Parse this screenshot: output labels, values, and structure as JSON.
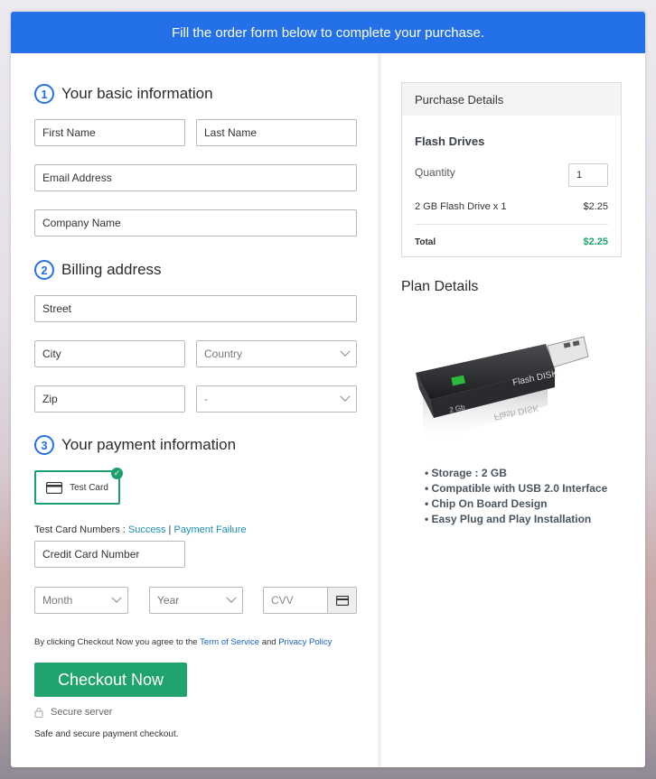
{
  "banner": "Fill the order form below to complete your purchase.",
  "sections": {
    "basic": {
      "num": "1",
      "title": "Your basic information"
    },
    "billing": {
      "num": "2",
      "title": "Billing address"
    },
    "payment": {
      "num": "3",
      "title": "Your payment information"
    }
  },
  "fields": {
    "first_name": "First Name",
    "last_name": "Last Name",
    "email": "Email Address",
    "company": "Company Name",
    "street": "Street",
    "city": "City",
    "country": "Country",
    "zip": "Zip",
    "state": "-",
    "card_number": "Credit Card Number",
    "month": "Month",
    "year": "Year",
    "cvv": "CVV"
  },
  "payment": {
    "test_card": "Test Card",
    "test_numbers_label": "Test Card Numbers : ",
    "success": "Success",
    "separator": " | ",
    "failure": "Payment Failure"
  },
  "terms": {
    "prefix": "By clicking Checkout Now you agree to the ",
    "tos": "Term of Service",
    "and": " and ",
    "privacy": "Privacy Policy"
  },
  "checkout_label": "Checkout Now",
  "secure_server": "Secure server",
  "secure_note": "Safe and secure payment checkout.",
  "purchase": {
    "header": "Purchase Details",
    "product": "Flash Drives",
    "quantity_label": "Quantity",
    "quantity_value": "1",
    "line_item": "2 GB Flash Drive x 1",
    "line_price": "$2.25",
    "total_label": "Total",
    "total_value": "$2.25"
  },
  "plan": {
    "title": "Plan Details",
    "brand_label": "Flash DISK",
    "size_label": "2 Gb",
    "features": [
      "Storage : 2 GB",
      "Compatible with USB 2.0 Interface",
      "Chip On Board Design",
      "Easy Plug and Play Installation"
    ]
  },
  "colors": {
    "primary": "#2470e8",
    "accent": "#20a36c",
    "total": "#20a36c"
  }
}
